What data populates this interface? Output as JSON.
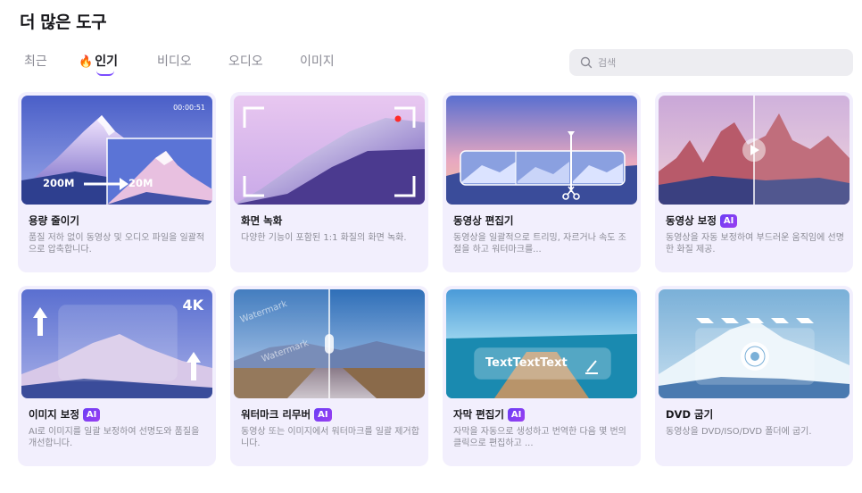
{
  "header": {
    "title": "더 많은 도구"
  },
  "tabs": [
    {
      "label": "최근"
    },
    {
      "label": "인기",
      "icon": "fire-icon",
      "active": true
    },
    {
      "label": "비디오"
    },
    {
      "label": "오디오"
    },
    {
      "label": "이미지"
    }
  ],
  "search": {
    "placeholder": "검색",
    "value": ""
  },
  "colors": {
    "accent": "#7c4dff",
    "card_bg": "#f2effd",
    "ai_badge": "#6a3df5"
  },
  "cards": [
    {
      "title": "용량 줄이기",
      "ai": false,
      "desc": "품질 저하 없이 동영상 및 오디오 파일을 일괄적으로 압축합니다.",
      "thumb": {
        "timecode": "00:00:51",
        "from": "200M",
        "to": "20M"
      }
    },
    {
      "title": "화면 녹화",
      "ai": false,
      "desc": "다양한 기능이 포함된 1:1 화질의 화면 녹화."
    },
    {
      "title": "동영상 편집기",
      "ai": false,
      "desc": "동영상을 일괄적으로 트리밍, 자르거나 속도 조절을 하고 워터마크를..."
    },
    {
      "title": "동영상 보정",
      "ai": true,
      "ai_label": "AI",
      "desc": "동영상을 자동 보정하여 부드러운 움직임에 선명한 화질 제공."
    },
    {
      "title": "이미지 보정",
      "ai": true,
      "ai_label": "AI",
      "desc": "AI로 이미지를 일괄 보정하여 선명도와 품질을 개선합니다.",
      "thumb": {
        "badge": "4K"
      }
    },
    {
      "title": "워터마크 리무버",
      "ai": true,
      "ai_label": "AI",
      "desc": "동영상 또는 이미지에서 워터마크를 일괄 제거합니다.",
      "thumb": {
        "watermark": "Watermark"
      }
    },
    {
      "title": "자막 편집기",
      "ai": true,
      "ai_label": "AI",
      "desc": "자막을 자동으로 생성하고 번역한 다음 몇 번의 클릭으로 편집하고 ...",
      "thumb": {
        "caption": "TextTextText"
      }
    },
    {
      "title": "DVD 굽기",
      "ai": false,
      "desc": "동영상을 DVD/ISO/DVD 폴더에 굽기."
    }
  ]
}
